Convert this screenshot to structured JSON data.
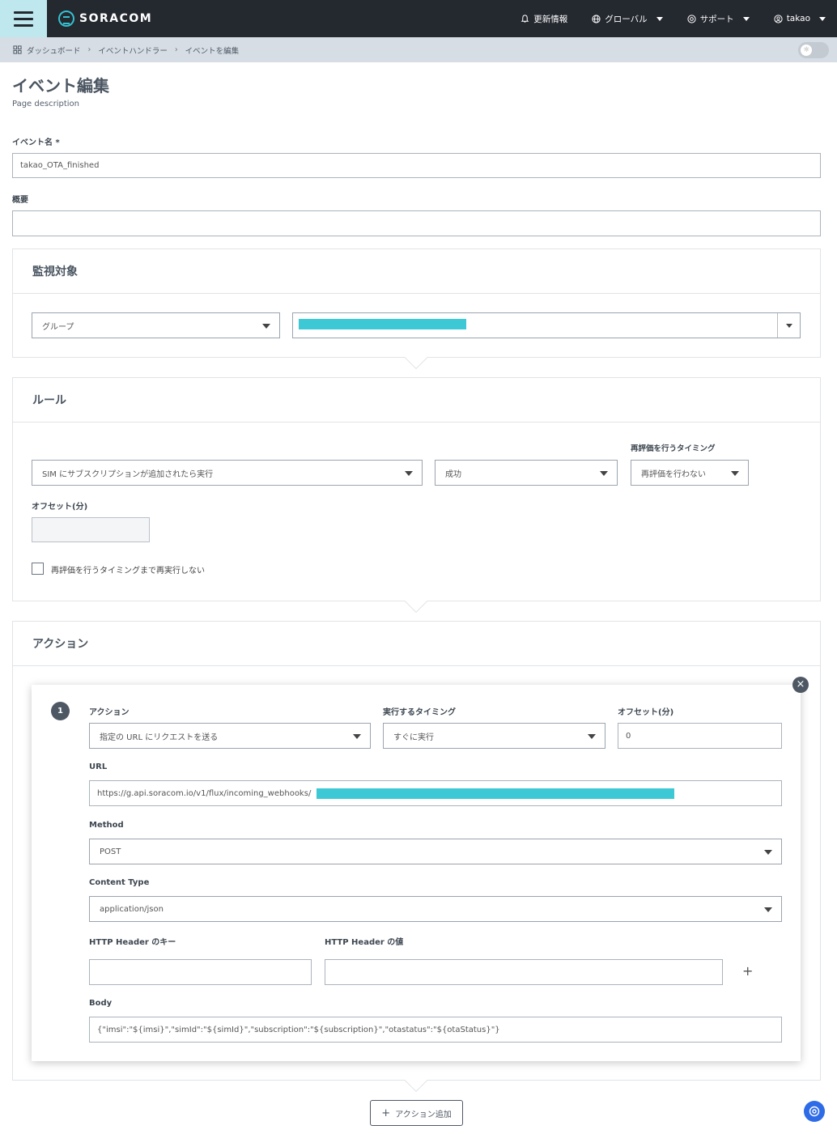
{
  "topbar": {
    "brand": "SORACOM",
    "nav": [
      {
        "label": "更新情報",
        "icon": "bell-icon"
      },
      {
        "label": "グローバル",
        "icon": "globe-icon"
      },
      {
        "label": "サポート",
        "icon": "support-icon"
      },
      {
        "label": "takao",
        "icon": "user-icon"
      }
    ]
  },
  "breadcrumb": [
    "ダッシュボード",
    "イベントハンドラー",
    "イベントを編集"
  ],
  "page": {
    "title": "イベント編集",
    "description": "Page description"
  },
  "form": {
    "event_name_label": "イベント名 *",
    "event_name_value": "takao_OTA_finished",
    "summary_label": "概要",
    "summary_value": ""
  },
  "target": {
    "title": "監視対象",
    "type_value": "グループ"
  },
  "rule": {
    "title": "ルール",
    "condition_value": "SIM にサブスクリプションが追加されたら実行",
    "status_value": "成功",
    "reeval_label": "再評価を行うタイミング",
    "reeval_value": "再評価を行わない",
    "offset_label": "オフセット(分)",
    "offset_value": "",
    "checkbox_label": "再評価を行うタイミングまで再実行しない"
  },
  "actions": {
    "title": "アクション",
    "step_number": "1",
    "action_label": "アクション",
    "action_value": "指定の URL にリクエストを送る",
    "timing_label": "実行するタイミング",
    "timing_value": "すぐに実行",
    "offset_label": "オフセット(分)",
    "offset_value": "0",
    "url_label": "URL",
    "url_value": "https://g.api.soracom.io/v1/flux/incoming_webhooks/",
    "method_label": "Method",
    "method_value": "POST",
    "content_type_label": "Content Type",
    "content_type_value": "application/json",
    "header_key_label": "HTTP Header のキー",
    "header_value_label": "HTTP Header の値",
    "body_label": "Body",
    "body_value": "{\"imsi\":\"${imsi}\",\"simId\":\"${simId}\",\"subscription\":\"${subscription}\",\"otastatus\":\"${otaStatus}\"}",
    "add_button": "アクション追加"
  }
}
